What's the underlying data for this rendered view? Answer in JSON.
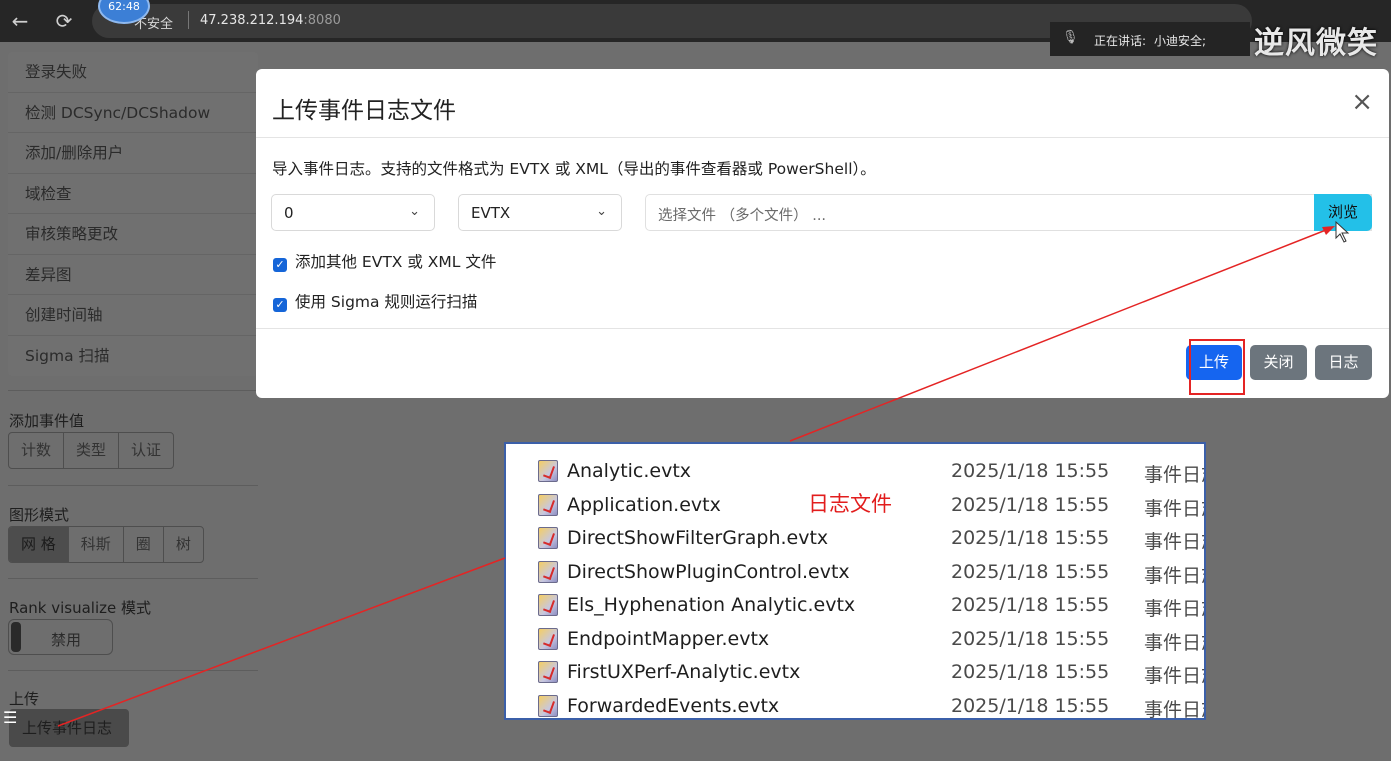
{
  "browser": {
    "back": "←",
    "reload": "⟳",
    "timer": "62:48",
    "security": "不安全",
    "host": "47.238.212.194",
    "port": ":8080"
  },
  "meeting": {
    "label": "正在讲话:",
    "speaker": "小迪安全;"
  },
  "watermark": "逆风微笑",
  "sidebar": {
    "items": [
      {
        "label": "登录失败"
      },
      {
        "label": "检测 DCSync/DCShadow"
      },
      {
        "label": "添加/删除用户"
      },
      {
        "label": "域检查"
      },
      {
        "label": "审核策略更改"
      },
      {
        "label": "差异图"
      },
      {
        "label": "创建时间轴"
      },
      {
        "label": "Sigma 扫描"
      }
    ],
    "add_event_title": "添加事件值",
    "add_event_buttons": [
      "计数",
      "类型",
      "认证"
    ],
    "graph_mode_title": "图形模式",
    "graph_mode_buttons": [
      "网 格",
      "科斯",
      "圈",
      "树"
    ],
    "rank_title": "Rank visualize 模式",
    "rank_toggle": "禁用",
    "upload_title": "上传",
    "upload_button": "上传事件日志"
  },
  "modal": {
    "title": "上传事件日志文件",
    "close": "×",
    "description": "导入事件日志。支持的文件格式为 EVTX 或 XML（导出的事件查看器或 PowerShell）。",
    "select1": "0",
    "select2": "EVTX",
    "file_placeholder": "选择文件 （多个文件） ...",
    "browse": "浏览",
    "check1": "添加其他 EVTX 或 XML 文件",
    "check2": "使用 Sigma 规则运行扫描",
    "buttons": {
      "upload": "上传",
      "close": "关闭",
      "log": "日志"
    }
  },
  "overlay": {
    "note": "日志文件",
    "files": [
      {
        "name": "Analytic.evtx",
        "date": "2025/1/18 15:55",
        "type": "事件日志"
      },
      {
        "name": "Application.evtx",
        "date": "2025/1/18 15:55",
        "type": "事件日志"
      },
      {
        "name": "DirectShowFilterGraph.evtx",
        "date": "2025/1/18 15:55",
        "type": "事件日志"
      },
      {
        "name": "DirectShowPluginControl.evtx",
        "date": "2025/1/18 15:55",
        "type": "事件日志"
      },
      {
        "name": "Els_Hyphenation Analytic.evtx",
        "date": "2025/1/18 15:55",
        "type": "事件日志"
      },
      {
        "name": "EndpointMapper.evtx",
        "date": "2025/1/18 15:55",
        "type": "事件日志"
      },
      {
        "name": "FirstUXPerf-Analytic.evtx",
        "date": "2025/1/18 15:55",
        "type": "事件日志"
      },
      {
        "name": "ForwardedEvents.evtx",
        "date": "2025/1/18 15:55",
        "type": "事件日志"
      }
    ]
  },
  "colors": {
    "primary": "#1565f0",
    "browse": "#23c0e8",
    "secondary": "#6c757d",
    "annotation_red": "#e42424"
  }
}
